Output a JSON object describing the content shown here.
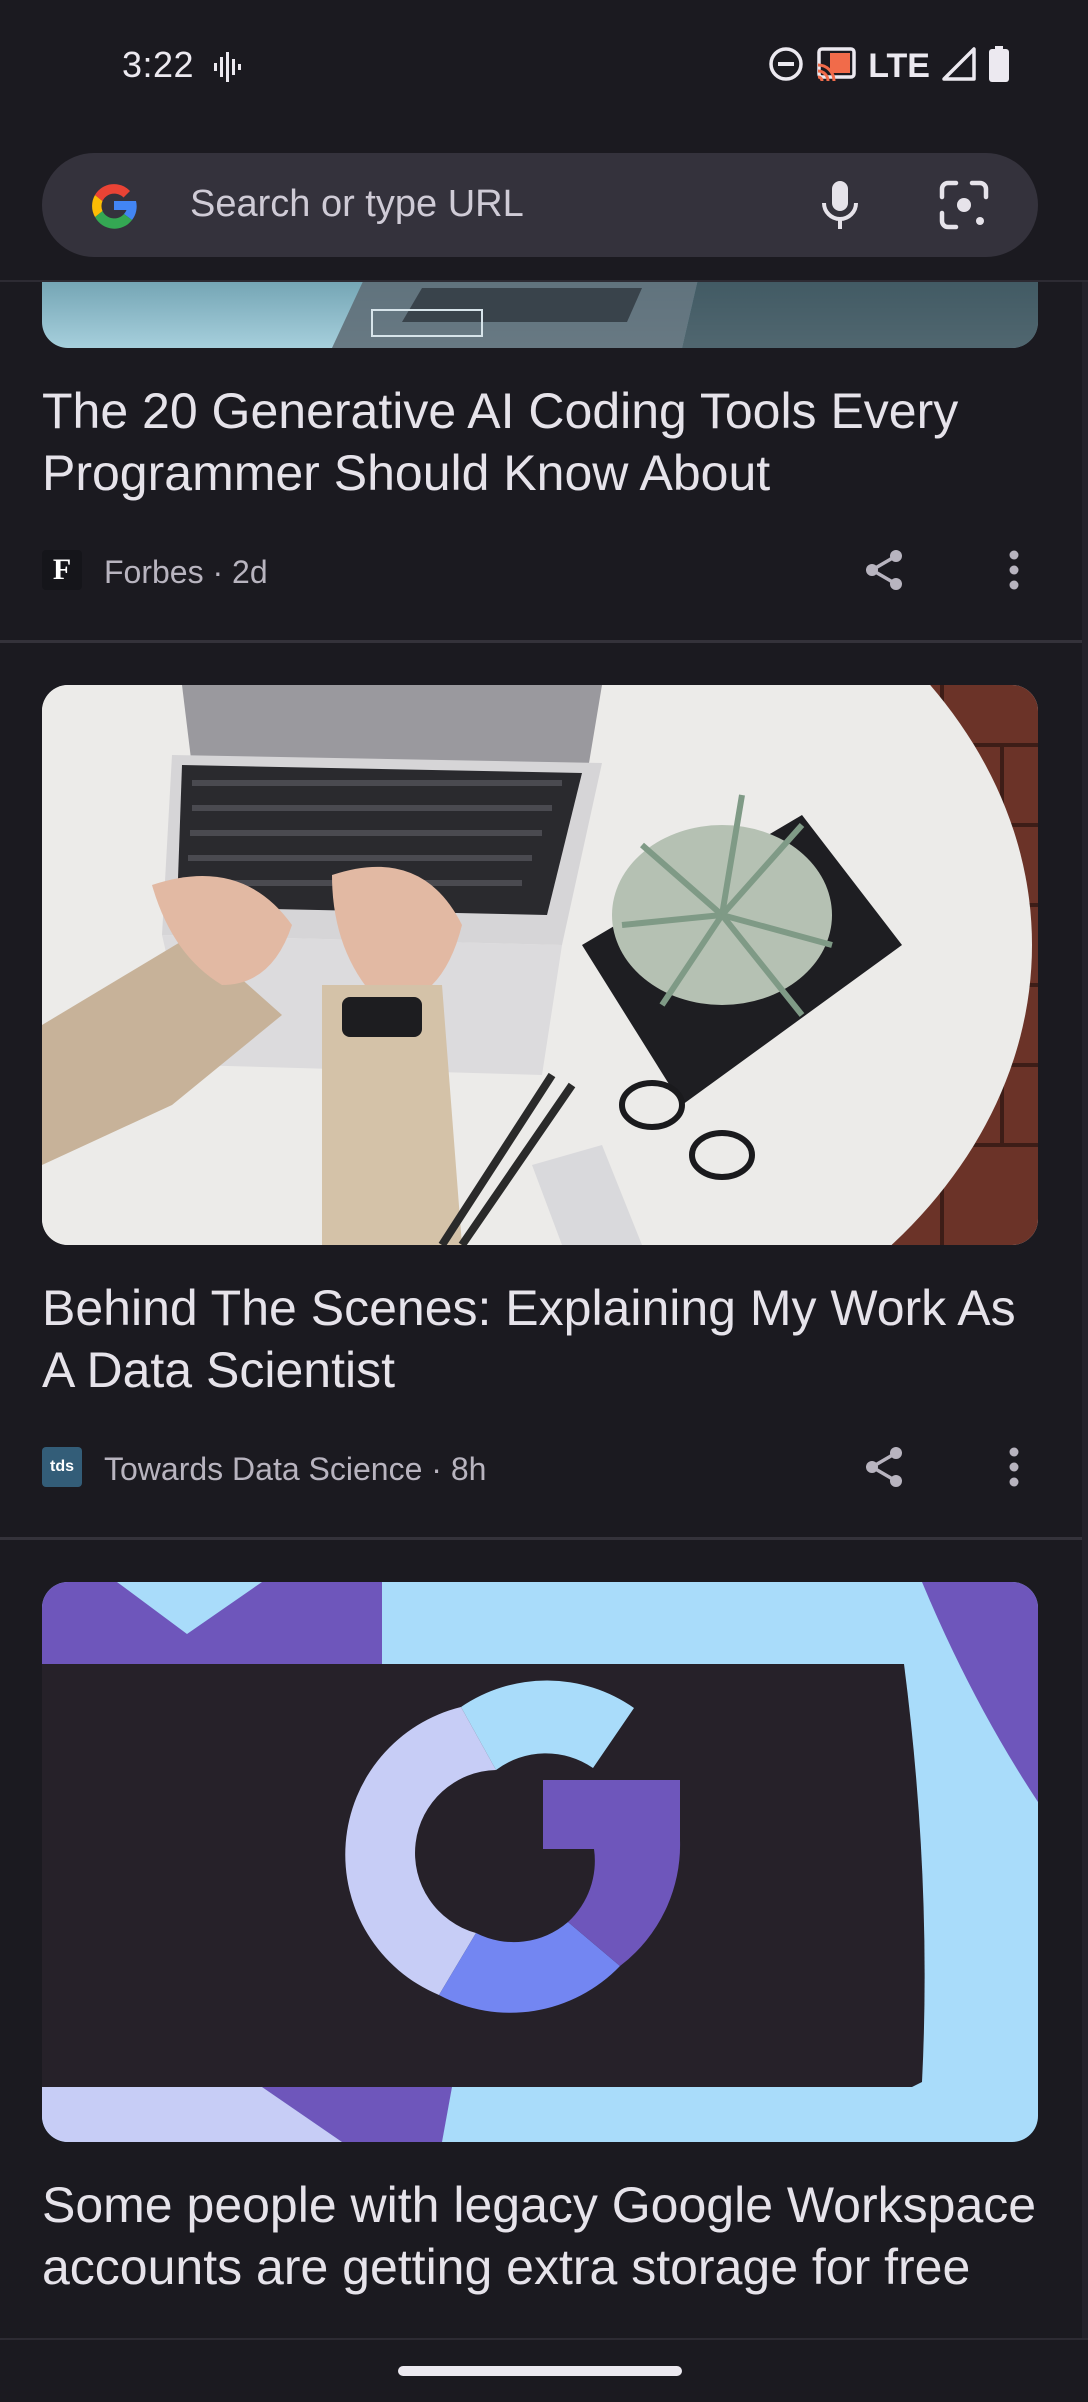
{
  "status_bar": {
    "time": "3:22",
    "network": "LTE"
  },
  "omnibox": {
    "placeholder": "Search or type URL"
  },
  "articles": [
    {
      "title": "The 20 Generative AI Coding Tools Every Programmer Should Know About",
      "publisher": "Forbes",
      "publisher_logo": "F",
      "age": "2d",
      "meta": "Forbes · 2d"
    },
    {
      "title": "Behind The Scenes: Explaining My Work As A Data Scientist",
      "publisher": "Towards Data Science",
      "publisher_logo": "tds",
      "age": "8h",
      "meta": "Towards Data Science · 8h"
    },
    {
      "title": "Some people with legacy Google Workspace accounts are getting extra storage for free"
    }
  ],
  "icons": {
    "status_left": "sound-wave-icon",
    "dnd": "do-not-disturb-icon",
    "cast": "cast-icon",
    "signal": "signal-icon",
    "battery": "battery-icon",
    "google": "google-g-icon",
    "mic": "microphone-icon",
    "lens": "lens-camera-icon",
    "share": "share-icon",
    "more": "more-vert-icon"
  },
  "colors": {
    "background": "#1b1a20",
    "omnibox": "#34323c",
    "text": "#e6e3ea",
    "secondary_text": "#b8b4bf"
  }
}
